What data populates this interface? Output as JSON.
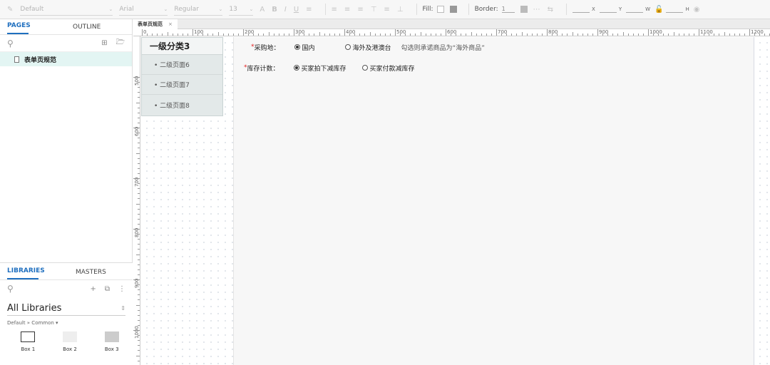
{
  "toolbar": {
    "style_select": "Default",
    "font_select": "Arial",
    "weight_select": "Regular",
    "size_select": "13",
    "fill_label": "Fill:",
    "border_label": "Border:",
    "border_value": "1",
    "x_label": "X",
    "y_label": "Y",
    "w_label": "W",
    "h_label": "H"
  },
  "left_panel": {
    "tabs": [
      "PAGES",
      "OUTLINE"
    ],
    "pages": [
      {
        "label": "表单页规范"
      }
    ]
  },
  "libraries": {
    "tabs": [
      "LIBRARIES",
      "MASTERS"
    ],
    "title": "All Libraries",
    "subtitle": "Default » Common ▾",
    "widgets": [
      {
        "label": "Box 1"
      },
      {
        "label": "Box 2"
      },
      {
        "label": "Box 3"
      }
    ]
  },
  "doc_tab": {
    "label": "表单页规范",
    "close": "×"
  },
  "ruler": {
    "h_labels": [
      "0",
      "100",
      "200",
      "300",
      "400",
      "500",
      "600",
      "700",
      "800",
      "900",
      "1000",
      "1100",
      "1200"
    ],
    "v_labels": [
      "500",
      "600",
      "700",
      "800",
      "900",
      "1000"
    ]
  },
  "category_nav": {
    "header": "一级分类3",
    "items": [
      "• 二级页面6",
      "• 二级页面7",
      "• 二级页面8"
    ]
  },
  "form": {
    "row1": {
      "required": "*",
      "label": "采购地：",
      "options": [
        {
          "label": "国内",
          "checked": true
        },
        {
          "label": "海外及港澳台",
          "checked": false
        }
      ],
      "hint": "勾选则承诺商品为“海外商品”"
    },
    "row2": {
      "required": "*",
      "label": "库存计数：",
      "options": [
        {
          "label": "买家拍下减库存",
          "checked": true
        },
        {
          "label": "买家付款减库存",
          "checked": false
        }
      ]
    }
  }
}
